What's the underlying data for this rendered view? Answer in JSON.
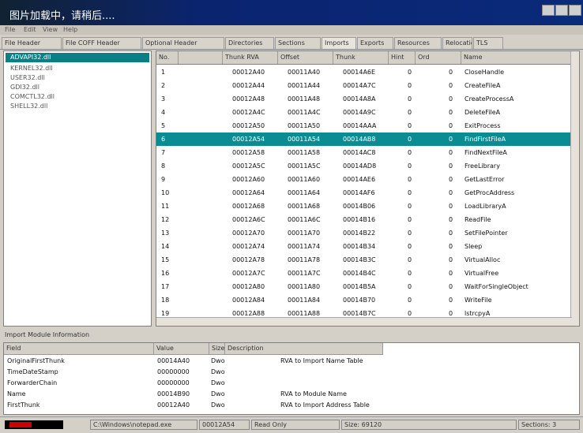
{
  "loading_overlay": "图片加载中，请稍后....",
  "menu": [
    "File",
    "Edit",
    "View",
    "Help"
  ],
  "tabs": [
    "File Header",
    "File COFF Header",
    "Optional Header",
    "Directories",
    "Sections",
    "Imports",
    "Exports",
    "Resources",
    "Relocations",
    "TLS"
  ],
  "tree": {
    "selected": "ADVAPI32.dll",
    "items": [
      "KERNEL32.dll",
      "USER32.dll",
      "GDI32.dll",
      "COMCTL32.dll",
      "SHELL32.dll"
    ]
  },
  "grid": {
    "columns": [
      "No.",
      "",
      "Thunk RVA",
      "Offset",
      "Thunk",
      "Hint",
      "Ord",
      "Name"
    ],
    "rows": [
      {
        "no": "1",
        "rva": "00012A40",
        "offset": "00011A40",
        "thunk": "00014A6E",
        "hint": "0",
        "ord": "0",
        "name": "CloseHandle"
      },
      {
        "no": "2",
        "rva": "00012A44",
        "offset": "00011A44",
        "thunk": "00014A7C",
        "hint": "0",
        "ord": "0",
        "name": "CreateFileA"
      },
      {
        "no": "3",
        "rva": "00012A48",
        "offset": "00011A48",
        "thunk": "00014A8A",
        "hint": "0",
        "ord": "0",
        "name": "CreateProcessA"
      },
      {
        "no": "4",
        "rva": "00012A4C",
        "offset": "00011A4C",
        "thunk": "00014A9C",
        "hint": "0",
        "ord": "0",
        "name": "DeleteFileA"
      },
      {
        "no": "5",
        "rva": "00012A50",
        "offset": "00011A50",
        "thunk": "00014AAA",
        "hint": "0",
        "ord": "0",
        "name": "ExitProcess"
      },
      {
        "no": "6",
        "rva": "00012A54",
        "offset": "00011A54",
        "thunk": "00014AB8",
        "hint": "0",
        "ord": "0",
        "name": "FindFirstFileA"
      },
      {
        "no": "7",
        "rva": "00012A58",
        "offset": "00011A58",
        "thunk": "00014AC8",
        "hint": "0",
        "ord": "0",
        "name": "FindNextFileA"
      },
      {
        "no": "8",
        "rva": "00012A5C",
        "offset": "00011A5C",
        "thunk": "00014AD8",
        "hint": "0",
        "ord": "0",
        "name": "FreeLibrary"
      },
      {
        "no": "9",
        "rva": "00012A60",
        "offset": "00011A60",
        "thunk": "00014AE6",
        "hint": "0",
        "ord": "0",
        "name": "GetLastError"
      },
      {
        "no": "10",
        "rva": "00012A64",
        "offset": "00011A64",
        "thunk": "00014AF6",
        "hint": "0",
        "ord": "0",
        "name": "GetProcAddress"
      },
      {
        "no": "11",
        "rva": "00012A68",
        "offset": "00011A68",
        "thunk": "00014B06",
        "hint": "0",
        "ord": "0",
        "name": "LoadLibraryA"
      },
      {
        "no": "12",
        "rva": "00012A6C",
        "offset": "00011A6C",
        "thunk": "00014B16",
        "hint": "0",
        "ord": "0",
        "name": "ReadFile"
      },
      {
        "no": "13",
        "rva": "00012A70",
        "offset": "00011A70",
        "thunk": "00014B22",
        "hint": "0",
        "ord": "0",
        "name": "SetFilePointer"
      },
      {
        "no": "14",
        "rva": "00012A74",
        "offset": "00011A74",
        "thunk": "00014B34",
        "hint": "0",
        "ord": "0",
        "name": "Sleep"
      },
      {
        "no": "15",
        "rva": "00012A78",
        "offset": "00011A78",
        "thunk": "00014B3C",
        "hint": "0",
        "ord": "0",
        "name": "VirtualAlloc"
      },
      {
        "no": "16",
        "rva": "00012A7C",
        "offset": "00011A7C",
        "thunk": "00014B4C",
        "hint": "0",
        "ord": "0",
        "name": "VirtualFree"
      },
      {
        "no": "17",
        "rva": "00012A80",
        "offset": "00011A80",
        "thunk": "00014B5A",
        "hint": "0",
        "ord": "0",
        "name": "WaitForSingleObject"
      },
      {
        "no": "18",
        "rva": "00012A84",
        "offset": "00011A84",
        "thunk": "00014B70",
        "hint": "0",
        "ord": "0",
        "name": "WriteFile"
      },
      {
        "no": "19",
        "rva": "00012A88",
        "offset": "00011A88",
        "thunk": "00014B7C",
        "hint": "0",
        "ord": "0",
        "name": "lstrcpyA"
      }
    ],
    "selected_index": 5
  },
  "bottom": {
    "label": "Import Module Information",
    "columns": [
      "Field",
      "Value",
      "Size",
      "Description"
    ],
    "rows": [
      {
        "field": "OriginalFirstThunk",
        "value": "00014A40",
        "size": "Dword",
        "desc": "RVA to Import Name Table"
      },
      {
        "field": "TimeDateStamp",
        "value": "00000000",
        "size": "Dword",
        "desc": ""
      },
      {
        "field": "ForwarderChain",
        "value": "00000000",
        "size": "Dword",
        "desc": ""
      },
      {
        "field": "Name",
        "value": "00014B90",
        "size": "Dword",
        "desc": "RVA to Module Name"
      },
      {
        "field": "FirstThunk",
        "value": "00012A40",
        "size": "Dword",
        "desc": "RVA to Import Address Table"
      }
    ]
  },
  "status": {
    "seg1": "C:\\Windows\\notepad.exe",
    "seg2": "00012A54",
    "seg3": "Read Only",
    "seg4": "Size: 69120",
    "seg5": "Sections: 3"
  }
}
